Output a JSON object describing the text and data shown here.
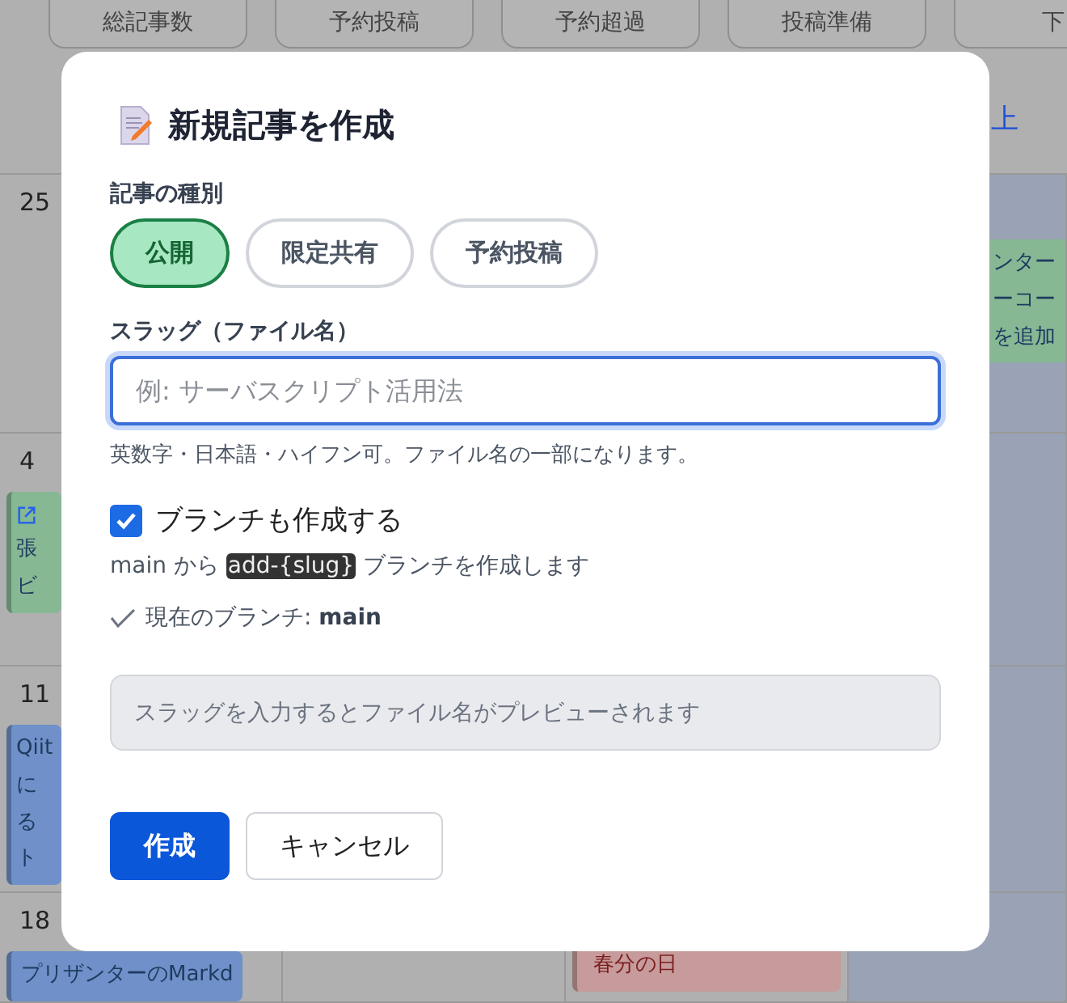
{
  "background": {
    "stat_cards": [
      "総記事数",
      "予約投稿",
      "予約超過",
      "投稿準備",
      "下"
    ],
    "toolbar_link": "上",
    "weeks": [
      {
        "cells": [
          {
            "day": "25"
          },
          {},
          {},
          {
            "events": [
              {
                "kind": "plain",
                "color": "#86b894",
                "lines": [
                  "ンター",
                  "ーコー",
                  "を追加"
                ]
              }
            ]
          }
        ]
      },
      {
        "cells": [
          {
            "day": "4",
            "events": [
              {
                "kind": "link",
                "color": "#86b894",
                "lines": [
                  "張",
                  "ビ"
                ]
              }
            ]
          },
          {},
          {},
          {}
        ]
      },
      {
        "cells": [
          {
            "day": "11",
            "events": [
              {
                "kind": "plain",
                "color": "#6f90c8",
                "lines": [
                  "Qiit",
                  "に",
                  "る",
                  "ト"
                ]
              }
            ]
          },
          {},
          {},
          {}
        ]
      },
      {
        "cells": [
          {
            "day": "18",
            "events": [
              {
                "kind": "plain",
                "color": "#6f90c8",
                "lines": [
                  "プリザンターのMarkd"
                ]
              }
            ]
          },
          {},
          {
            "events": [
              {
                "kind": "plain",
                "color": "#c79b9b",
                "lines": [
                  "春分の日"
                ]
              }
            ]
          },
          {}
        ]
      }
    ]
  },
  "dialog": {
    "title": "新規記事を作成",
    "type_label": "記事の種別",
    "types": [
      {
        "label": "公開",
        "selected": true
      },
      {
        "label": "限定共有",
        "selected": false
      },
      {
        "label": "予約投稿",
        "selected": false
      }
    ],
    "slug_label": "スラッグ（ファイル名）",
    "slug": {
      "placeholder": "例: サーバスクリプト活用法"
    },
    "slug_hint": "英数字・日本語・ハイフン可。ファイル名の一部になります。",
    "branch_checkbox": {
      "label": "ブランチも作成する",
      "checked": true
    },
    "branch_note": {
      "before": "main から",
      "code": "add-{slug}",
      "after": "ブランチを作成します"
    },
    "current_branch": "現在のブランチ: **main**",
    "preview": "スラッグを入力するとファイル名がプレビューされます",
    "buttons": [
      {
        "label": "作成",
        "kind": "primary"
      },
      {
        "label": "キャンセル",
        "kind": "secondary"
      }
    ]
  }
}
